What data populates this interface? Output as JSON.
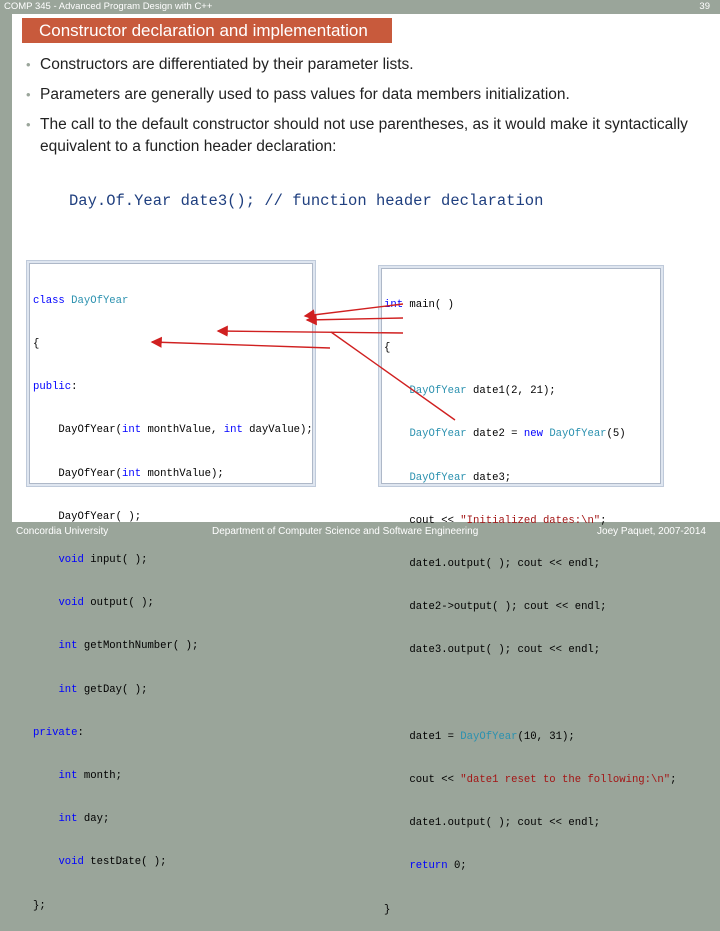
{
  "header": {
    "course": "COMP 345 - Advanced Program Design with C++",
    "slide_number": "39"
  },
  "title": "Constructor declaration and implementation",
  "bullets": [
    "Constructors are differentiated by their parameter lists.",
    "Parameters are generally used to pass values for data members initialization.",
    "The call to the default constructor should not use parentheses, as it would make it syntactically equivalent to a function header declaration:"
  ],
  "bullet_marker": "•",
  "code_example": "Day.Of.Year date3(); // function header declaration",
  "class_code": {
    "lines": [
      "class DayOfYear",
      "{",
      "public:",
      "    DayOfYear(int monthValue, int dayValue);",
      "    DayOfYear(int monthValue);",
      "    DayOfYear( );",
      "    void input( );",
      "    void output( );",
      "    int getMonthNumber( );",
      "    int getDay( );",
      "private:",
      "    int month;",
      "    int day;",
      "    void testDate( );",
      "};"
    ]
  },
  "main_code": {
    "lines": [
      "int main( )",
      "{",
      "    DayOfYear date1(2, 21);",
      "    DayOfYear date2 = new DayOfYear(5)",
      "    DayOfYear date3;",
      "    cout << \"Initialized dates:\\n\";",
      "    date1.output( ); cout << endl;",
      "    date2->output( ); cout << endl;",
      "    date3.output( ); cout << endl;",
      "",
      "    date1 = DayOfYear(10, 31);",
      "    cout << \"date1 reset to the following:\\n\";",
      "    date1.output( ); cout << endl;",
      "    return 0;",
      "}"
    ]
  },
  "footer": {
    "left": "Concordia University",
    "center": "Department of Computer Science and Software Engineering",
    "right": "Joey Paquet, 2007-2014"
  },
  "colors": {
    "title_bar": "#c85a3c",
    "background": "#9aa59a",
    "keyword": "#0000ff",
    "type": "#2b91af",
    "string": "#a31515",
    "arrow": "#d02020",
    "code_example": "#1f3f7f"
  }
}
